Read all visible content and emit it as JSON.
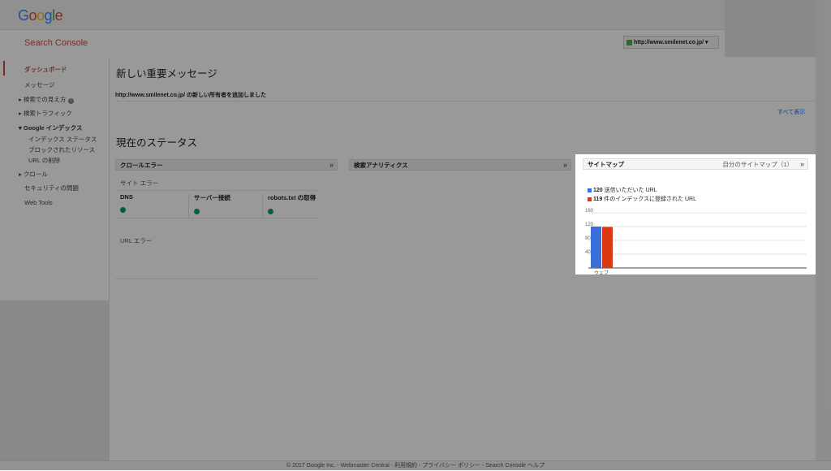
{
  "header": {
    "logo": [
      "G",
      "o",
      "o",
      "g",
      "l",
      "e"
    ],
    "logo_colors": [
      "#4285F4",
      "#EA4335",
      "#FBBC05",
      "#4285F4",
      "#34A853",
      "#EA4335"
    ],
    "product": "Search Console",
    "site": "http://www.smilenet.co.jp/"
  },
  "sidebar": {
    "dashboard": "ダッシュボード",
    "messages": "メッセージ",
    "appearance": "検索での見え方",
    "traffic": "検索トラフィック",
    "index": "Google インデックス",
    "index_status": "インデックス ステータス",
    "blocked": "ブロックされたリソース",
    "removal": "URL の削除",
    "crawl": "クロール",
    "security": "セキュリティの問題",
    "webtools": "Web Tools"
  },
  "main": {
    "messages_title": "新しい重要メッセージ",
    "message_site": "http://www.smilenet.co.jp/",
    "message_text": " の新しい所有者を追加しました",
    "view_all": "すべて表示",
    "status_title": "現在のステータス",
    "crawl_errors": "クロールエラー",
    "site_errors": "サイト エラー",
    "dns": "DNS",
    "server": "サーバー接続",
    "robots": "robots.txt の取得",
    "url_errors": "URL エラー",
    "analytics": "検索アナリティクス",
    "sitemaps": "サイトマップ",
    "my_sitemaps": "自分のサイトマップ（1）"
  },
  "chart_data": {
    "type": "bar",
    "categories": [
      "ウェブ"
    ],
    "series": [
      {
        "name": "送信いただいた URL",
        "value_label": "120",
        "values": [
          120
        ],
        "color": "#3b6fd8"
      },
      {
        "name": "件のインデックスに登録された URL",
        "value_label": "119",
        "values": [
          119
        ],
        "color": "#dc3912"
      }
    ],
    "yticks": [
      "160",
      "120",
      "80",
      "40"
    ],
    "ylim": [
      0,
      160
    ]
  },
  "footer": "© 2017 Google Inc. - Webmaster Central - 利用規約 - プライバシー ポリシー - Search Console ヘルプ"
}
